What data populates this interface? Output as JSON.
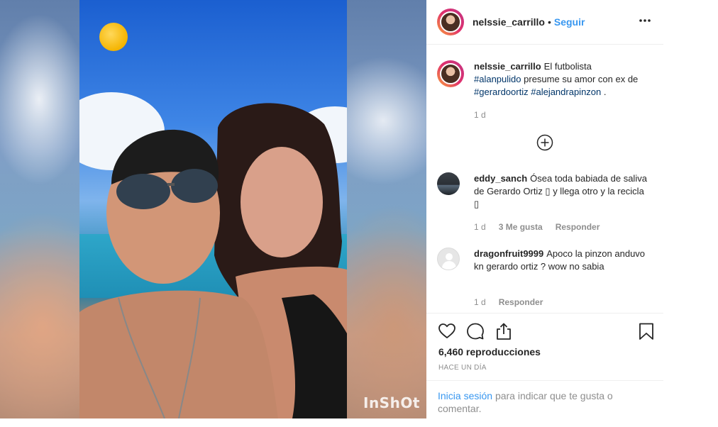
{
  "media": {
    "watermark": "InShOt"
  },
  "header": {
    "username": "nelssie_carrillo",
    "separator": "•",
    "follow_label": "Seguir"
  },
  "caption": {
    "username": "nelssie_carrillo",
    "text_1": "El futbolista",
    "tag_1": "#alanpulido",
    "text_2": "presume su amor con ex de",
    "tag_2": "#gerardoortiz",
    "tag_3": "#alejandrapinzon",
    "text_3": ".",
    "time": "1 d"
  },
  "comments": [
    {
      "username": "eddy_sanch",
      "text": "Ósea toda babiada de saliva de Gerardo Ortiz ▯ y llega otro y la recicla ▯",
      "time": "1 d",
      "likes": "3 Me gusta",
      "reply_label": "Responder"
    },
    {
      "username": "dragonfruit9999",
      "text": "Apoco la pinzon anduvo kn gerardo ortiz ? wow no sabia",
      "time": "1 d",
      "reply_label": "Responder"
    }
  ],
  "stats": {
    "views": "6,460 reproducciones",
    "posted": "Hace un día"
  },
  "login_prompt": {
    "link": "Inicia sesión",
    "text": "para indicar que te gusta o comentar."
  },
  "icons": {
    "more": "more-options-icon",
    "load_more": "plus-circle-icon",
    "like": "heart-icon",
    "comment": "comment-icon",
    "share": "share-icon",
    "save": "bookmark-icon"
  },
  "colors": {
    "link_blue": "#3897f0",
    "hashtag": "#003569",
    "muted": "#8e8e8e",
    "text": "#262626"
  }
}
